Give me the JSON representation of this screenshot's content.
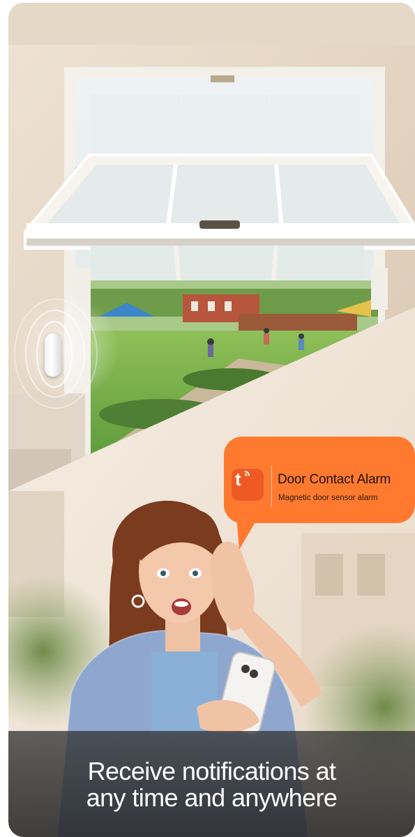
{
  "notification": {
    "title": "Door Contact Alarm",
    "subtitle": "Magnetic door sensor alarm",
    "app_icon_letter": "t",
    "app_icon": "tuya-app-icon",
    "alert_icon": "siren-icon",
    "bubble_color": "#ff7a2e"
  },
  "caption": {
    "line1": "Receive notifications at",
    "line2": "any time and anywhere"
  }
}
